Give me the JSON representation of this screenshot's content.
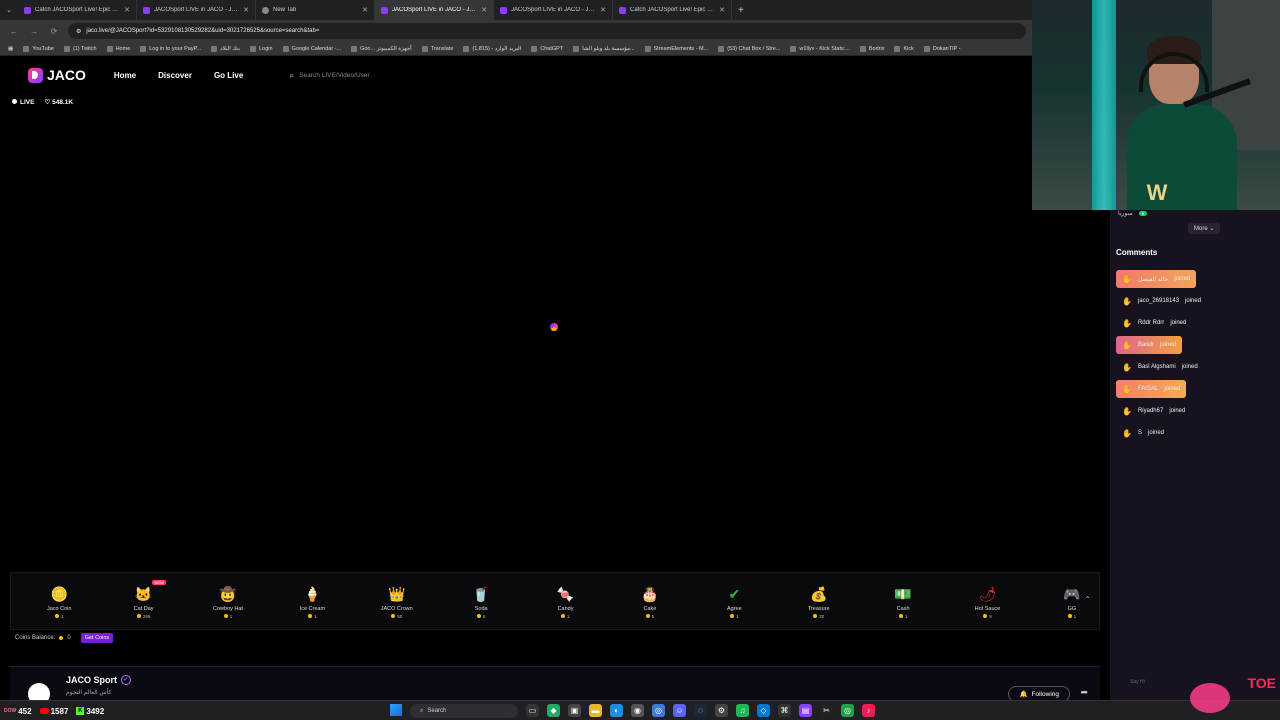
{
  "browser": {
    "tabs": [
      {
        "title": "Catch JACOSport Live! Epic Spo",
        "active": false
      },
      {
        "title": "JACOSport LIVE in JACO - JACO",
        "active": false
      },
      {
        "title": "New Tab",
        "active": false
      },
      {
        "title": "JACOSport LIVE in JACO - JACO",
        "active": true
      },
      {
        "title": "JACOSport LIVE in JACO - JACO",
        "active": false
      },
      {
        "title": "Catch JACOSport Live! Epic Spo",
        "active": false
      }
    ],
    "url": "jaco.live/@JACOSport?id=5329108130529282&uid=3021726525&source=search&tab=",
    "bookmarks": [
      "YouTube",
      "(1) Twitch",
      "Home",
      "Log in to your PayP...",
      "بنك البلاد",
      "Login",
      "Google Calendar -...",
      "Goo... أجهزة الكمبيوتر",
      "Translate",
      "البريد الوارد - (1,815)",
      "ChatGPT",
      "مؤسسة بلد ويلو الشا...",
      "StreamElements - M...",
      "(53) Chat Box / Stre...",
      "w1llyv - Kick Stats:...",
      "Bodrix",
      "Kick",
      "DokanTIP -"
    ]
  },
  "header": {
    "logo": "JACO",
    "nav": [
      "Home",
      "Discover",
      "Go Live"
    ],
    "search_placeholder": "Search LIVE/Video/User"
  },
  "live": {
    "label": "LIVE",
    "likes": "548.1K"
  },
  "gifts": [
    {
      "name": "Jaco Coin",
      "price": "1",
      "icon": "🪙",
      "color": "#e6b800"
    },
    {
      "name": "Cat Day",
      "price": "299",
      "icon": "🐱",
      "color": "#cccccc",
      "badge": "NEW"
    },
    {
      "name": "Cowboy Hat",
      "price": "1",
      "icon": "🤠",
      "color": "#8b5a2b"
    },
    {
      "name": "Ice Cream",
      "price": "1",
      "icon": "🍦",
      "color": "#f5c3a0"
    },
    {
      "name": "JACO Crown",
      "price": "50",
      "icon": "👑",
      "color": "#a066ff"
    },
    {
      "name": "Soda",
      "price": "6",
      "icon": "🥤",
      "color": "#6fcf5a"
    },
    {
      "name": "Candy",
      "price": "1",
      "icon": "🍬",
      "color": "#f0a050"
    },
    {
      "name": "Cake",
      "price": "5",
      "icon": "🎂",
      "color": "#ff6f7a"
    },
    {
      "name": "Agree",
      "price": "1",
      "icon": "✔",
      "color": "#1fbf3a"
    },
    {
      "name": "Treasure",
      "price": "20",
      "icon": "💰",
      "color": "#8a6a2a"
    },
    {
      "name": "Cash",
      "price": "1",
      "icon": "💵",
      "color": "#c8a050"
    },
    {
      "name": "Hot Sauce",
      "price": "9",
      "icon": "🌶",
      "color": "#e03030"
    },
    {
      "name": "GG",
      "price": "1",
      "icon": "🎮",
      "color": "#5a7aff"
    }
  ],
  "balance": {
    "label": "Coins Balance:",
    "value": "0",
    "button": "Get Coins"
  },
  "streamer": {
    "name": "JACO Sport",
    "subtitle": "كأس العالم النجوم",
    "follow_label": "Following"
  },
  "panel": {
    "top_user": "ﺳﻮﺭﻳﺎ",
    "more_label": "More",
    "comments_title": "Comments",
    "comments": [
      {
        "user": "خالد الفيصل",
        "text": "joined",
        "style": "hl1"
      },
      {
        "user": "jaco_26918143",
        "text": "joined",
        "style": ""
      },
      {
        "user": "Rddr Rdrr",
        "text": "joined",
        "style": ""
      },
      {
        "user": "Bandr",
        "text": "joined",
        "style": "hl2"
      },
      {
        "user": "Basl Algshami",
        "text": "joined",
        "style": ""
      },
      {
        "user": "FAISAL",
        "text": "joined",
        "style": "hl3"
      },
      {
        "user": "Riyadh67",
        "text": "joined",
        "style": ""
      },
      {
        "user": "S",
        "text": "joined",
        "style": ""
      }
    ],
    "say_hi": "Say Hi"
  },
  "taskbar": {
    "stats": [
      {
        "label": "452",
        "platform": "DOW"
      },
      {
        "label": "1587",
        "platform": "youtube"
      },
      {
        "label": "3492",
        "platform": "kick"
      }
    ],
    "search_label": "Search"
  }
}
